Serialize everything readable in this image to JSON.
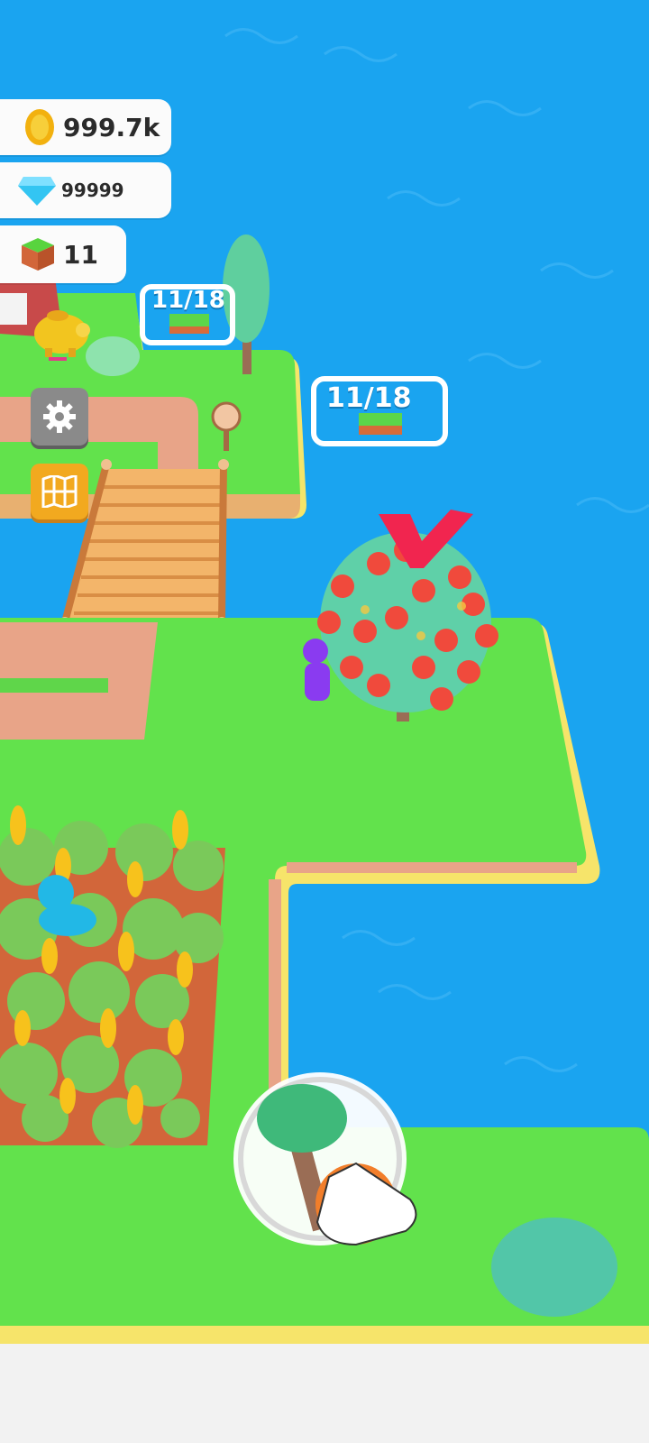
{
  "hud": {
    "coins": "999.7k",
    "gems": "99999",
    "land_blocks": "11"
  },
  "plots": [
    {
      "label": "11/18"
    },
    {
      "label": "11/18"
    }
  ],
  "icons": {
    "coin": "coin-icon",
    "gem": "diamond-icon",
    "land": "grass-block-icon",
    "piggy": "piggy-bank-icon",
    "settings": "gear-icon",
    "map": "map-icon",
    "action": "tree-chop-tap-icon"
  },
  "colors": {
    "water": "#1aa4f0",
    "grass": "#5fe04a",
    "path": "#e9a27f",
    "edge": "#f6e36b",
    "map_button": "#f2a91f",
    "settings_button": "#8a8a8a"
  }
}
